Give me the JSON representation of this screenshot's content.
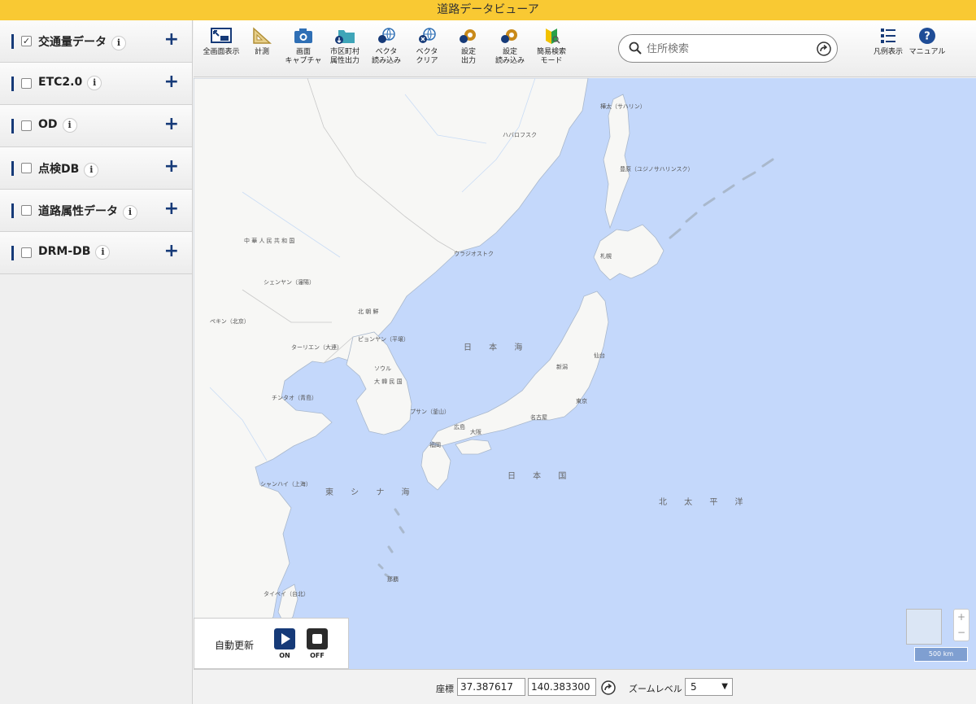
{
  "app": {
    "title": "道路データビューア"
  },
  "sidebar": {
    "layers": [
      {
        "label": "交通量データ",
        "checked": true
      },
      {
        "label": "ETC2.0",
        "checked": false
      },
      {
        "label": "OD",
        "checked": false
      },
      {
        "label": "点検DB",
        "checked": false
      },
      {
        "label": "道路属性データ",
        "checked": false
      },
      {
        "label": "DRM-DB",
        "checked": false
      }
    ],
    "info_glyph": "i",
    "plus_glyph": "+",
    "check_glyph": "✓"
  },
  "toolbar": {
    "fullscreen": "全画面表示",
    "measure": "計測",
    "capture_1": "画面",
    "capture_2": "キャプチャ",
    "municipal_1": "市区町村",
    "municipal_2": "属性出力",
    "vector_load_1": "ベクタ",
    "vector_load_2": "読み込み",
    "vector_clear_1": "ベクタ",
    "vector_clear_2": "クリア",
    "settings_out_1": "設定",
    "settings_out_2": "出力",
    "settings_in_1": "設定",
    "settings_in_2": "読み込み",
    "simple_search_1": "簡易検索",
    "simple_search_2": "モード",
    "legend": "凡例表示",
    "manual": "マニュアル"
  },
  "search": {
    "placeholder": "住所検索",
    "value": ""
  },
  "map": {
    "labels": {
      "sakhalin": "樺太（サハリン）",
      "khabarovsk": "ハバロフスク",
      "toyohara": "豊原（ユジノサハリンスク）",
      "vladivostok": "ウラジオストク",
      "china": "中 華 人 民 共 和 国",
      "shenyang": "シェンヤン（瀋陽）",
      "beijing": "ペキン（北京）",
      "dprk": "北 朝 鮮",
      "pyongyang": "ピョンヤン（平壌）",
      "dalian": "ターリエン（大連）",
      "seoul": "ソウル",
      "rok": "大 韓 民 国",
      "qingdao": "チンタオ（青島）",
      "busan": "プサン（釜山）",
      "shanghai": "シャンハイ（上海）",
      "taipei": "タイペイ（台北）",
      "sapporo": "札幌",
      "sendai": "仙台",
      "niigata": "新潟",
      "tokyo": "東京",
      "nagoya": "名古屋",
      "osaka": "大阪",
      "hiroshima": "広島",
      "fukuoka": "福岡",
      "naha": "那覇",
      "sea_of_japan": "日 本 海",
      "japan": "日 本 国",
      "east_china_sea": "東 シ ナ 海",
      "pacific": "北 太 平 洋"
    },
    "scale_label": "500 km",
    "zoom_in": "+",
    "zoom_out": "−"
  },
  "auto_update": {
    "label": "自動更新",
    "on": "ON",
    "off": "OFF"
  },
  "status": {
    "coord_label": "座標",
    "lat": "37.387617",
    "lon": "140.383300",
    "zoom_label": "ズームレベル",
    "zoom_value": "5"
  },
  "colors": {
    "title_bar": "#f9c933",
    "accent": "#163a78",
    "sea": "#c4d8fb",
    "land": "#f7f7f5"
  }
}
